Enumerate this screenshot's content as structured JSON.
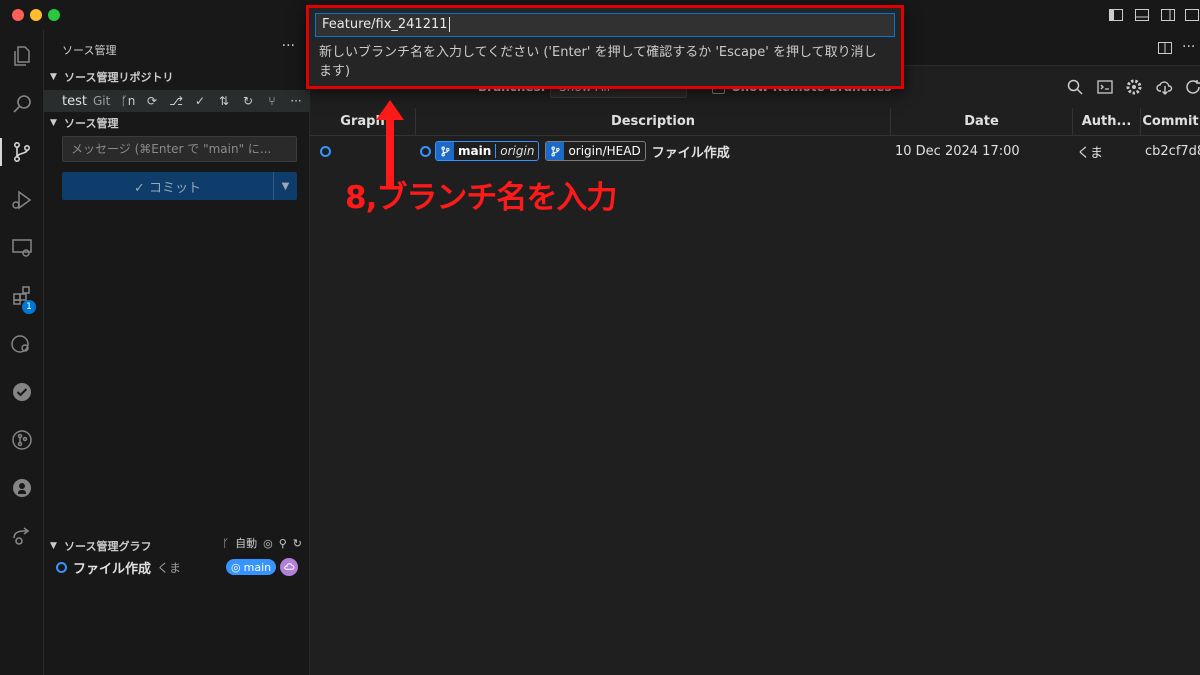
{
  "titlebar": {
    "window_controls": [
      "close",
      "minimize",
      "maximize"
    ]
  },
  "activitybar": {
    "items": [
      {
        "name": "explorer",
        "icon": "files-icon"
      },
      {
        "name": "search",
        "icon": "search-icon"
      },
      {
        "name": "source-control",
        "icon": "source-control-icon"
      },
      {
        "name": "run-debug",
        "icon": "run-debug-icon"
      },
      {
        "name": "remote-explorer",
        "icon": "remote-explorer-icon"
      },
      {
        "name": "extensions",
        "icon": "extensions-icon",
        "badge": "1"
      },
      {
        "name": "git-lens",
        "icon": "gitlens-icon"
      },
      {
        "name": "testing",
        "icon": "check-circle-icon"
      },
      {
        "name": "git-graph",
        "icon": "git-graph-icon"
      },
      {
        "name": "github",
        "icon": "github-icon"
      },
      {
        "name": "live-share",
        "icon": "live-share-icon"
      }
    ]
  },
  "sidebar": {
    "title": "ソース管理",
    "more": "···",
    "repositories_header": "ソース管理リポジトリ",
    "repo": {
      "name": "test",
      "kind": "Git"
    },
    "changes_header": "ソース管理",
    "message_placeholder": "メッセージ (⌘Enter で \"main\" に...",
    "commit_label": "✓ コミット",
    "graph_header": "ソース管理グラフ",
    "graph_auto": "自動",
    "graph_commit": {
      "message": "ファイル作成",
      "author": "くま",
      "branch": "main"
    }
  },
  "graph_view": {
    "branches_label": "Branches:",
    "branches_value": "Show All",
    "show_remote_label": "Show Remote Branches",
    "columns": [
      "Graph",
      "Description",
      "Date",
      "Auth...",
      "Commit"
    ],
    "rows": [
      {
        "local_branch": "main",
        "remote": "origin",
        "remote_head": "origin/HEAD",
        "description": "ファイル作成",
        "date": "10 Dec 2024 17:00",
        "author": "くま",
        "commit": "cb2cf7d8"
      }
    ]
  },
  "quick_input": {
    "value": "Feature/fix_241211",
    "message": "新しいブランチ名を入力してください ('Enter' を押して確認するか 'Escape' を押して取り消します)"
  },
  "annotation": {
    "text": "8,ブランチ名を入力",
    "color": "#ff1a1a"
  },
  "colors": {
    "accent": "#0078d4",
    "highlight_box": "#e00000",
    "branch_blue": "#3794ff"
  }
}
